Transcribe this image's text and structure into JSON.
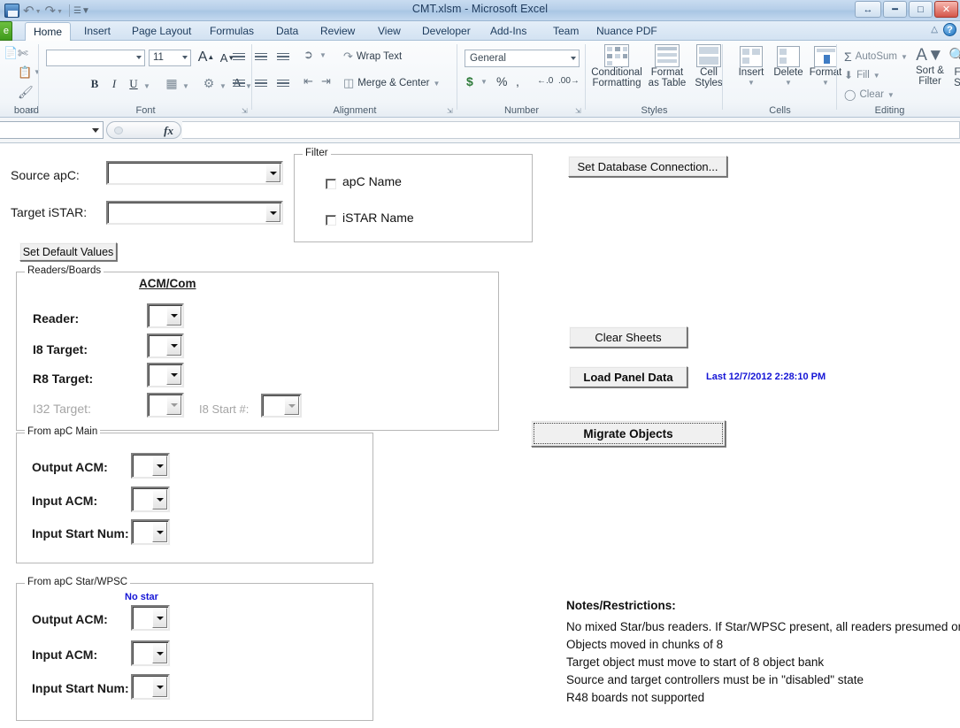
{
  "window": {
    "title": "CMT.xlsm  -  Microsoft Excel",
    "quick_access": [
      "save-icon",
      "undo-icon",
      "redo-icon",
      "customize-qat-icon"
    ],
    "controls": {
      "restore_window": "restore-icon",
      "minimize": "minimize-icon",
      "maximize": "maximize-icon",
      "close": "close-icon"
    }
  },
  "ribbon": {
    "file_tab": "e",
    "tabs": [
      {
        "label": "Home",
        "active": true
      },
      {
        "label": "Insert",
        "active": false
      },
      {
        "label": "Page Layout",
        "active": false
      },
      {
        "label": "Formulas",
        "active": false
      },
      {
        "label": "Data",
        "active": false
      },
      {
        "label": "Review",
        "active": false
      },
      {
        "label": "View",
        "active": false
      },
      {
        "label": "Developer",
        "active": false
      },
      {
        "label": "Add-Ins",
        "active": false
      },
      {
        "label": "Team",
        "active": false
      },
      {
        "label": "Nuance PDF",
        "active": false
      }
    ],
    "groups": {
      "clipboard": {
        "label": "board",
        "buttons": [
          "paste-icon",
          "cut-icon",
          "copy-icon",
          "format-painter-icon"
        ]
      },
      "font": {
        "label": "Font",
        "font_name": "",
        "font_size": "11",
        "buttons": [
          "grow-font",
          "shrink-font",
          "bold",
          "italic",
          "underline",
          "borders",
          "fill-color",
          "font-color"
        ],
        "bold": "B",
        "italic": "I",
        "underline": "U",
        "grow": "A",
        "shrink": "A"
      },
      "alignment": {
        "label": "Alignment",
        "wrap_text": "Wrap Text",
        "merge_center": "Merge & Center"
      },
      "number": {
        "label": "Number",
        "format": "General",
        "currency": "$",
        "percent": "%",
        "comma": ","
      },
      "styles": {
        "label": "Styles",
        "conditional_formatting": "Conditional\nFormatting",
        "conditional_formatting_l1": "Conditional",
        "conditional_formatting_l2": "Formatting",
        "format_as_table_l1": "Format",
        "format_as_table_l2": "as Table",
        "cell_styles_l1": "Cell",
        "cell_styles_l2": "Styles"
      },
      "cells": {
        "label": "Cells",
        "insert": "Insert",
        "delete": "Delete",
        "format": "Format"
      },
      "editing": {
        "label": "Editing",
        "autosum": "AutoSum",
        "fill": "Fill",
        "clear": "Clear",
        "sort_filter_l1": "Sort &",
        "sort_filter_l2": "Filter",
        "find_select_l1": "F",
        "find_select_l2": "S",
        "sigma": "Σ"
      }
    }
  },
  "formula_bar": {
    "name_box": "",
    "fx_label": "fx",
    "formula": ""
  },
  "form": {
    "source_apc_label": "Source apC:",
    "source_apc_value": "",
    "target_istar_label": "Target iSTAR:",
    "target_istar_value": "",
    "set_default_values_button": "Set Default Values",
    "set_database_connection_button": "Set Database Connection...",
    "clear_sheets_button": "Clear Sheets",
    "load_panel_data_button": "Load Panel Data",
    "last_load_timestamp": "Last 12/7/2012 2:28:10 PM",
    "migrate_objects_button": "Migrate Objects",
    "filter": {
      "caption": "Filter",
      "checkboxes": [
        {
          "label": "apC Name",
          "checked": false
        },
        {
          "label": "iSTAR Name",
          "checked": false
        }
      ]
    },
    "readers_boards": {
      "caption": "Readers/Boards",
      "column_header": "ACM/Com",
      "rows": [
        {
          "label": "Reader:",
          "value": "",
          "disabled": false
        },
        {
          "label": "I8 Target:",
          "value": "",
          "disabled": false
        },
        {
          "label": "R8 Target:",
          "value": "",
          "disabled": false
        },
        {
          "label": "I32 Target:",
          "value": "",
          "disabled": true
        }
      ],
      "i8_start_label": "I8 Start #:",
      "i8_start_value": ""
    },
    "from_apc_main": {
      "caption": "From apC Main",
      "rows": [
        {
          "label": "Output ACM:",
          "value": ""
        },
        {
          "label": "Input ACM:",
          "value": ""
        },
        {
          "label": "Input Start Num:",
          "value": ""
        }
      ]
    },
    "from_apc_star": {
      "caption": "From apC Star/WPSC",
      "status": "No star",
      "rows": [
        {
          "label": "Output ACM:",
          "value": ""
        },
        {
          "label": "Input ACM:",
          "value": ""
        },
        {
          "label": "Input Start Num:",
          "value": ""
        }
      ]
    },
    "notes": {
      "title": "Notes/Restrictions:",
      "lines": [
        "No mixed Star/bus readers. If Star/WPSC present, all readers presumed on",
        "Objects moved in chunks of 8",
        "Target object must move to start of 8 object bank",
        "Source and target controllers must be in \"disabled\" state",
        "R48 boards not supported"
      ]
    }
  },
  "colors": {
    "accent_blue": "#1414d6",
    "file_tab_green": "#3f9b1c",
    "title_bar": "#b6cfe9"
  }
}
